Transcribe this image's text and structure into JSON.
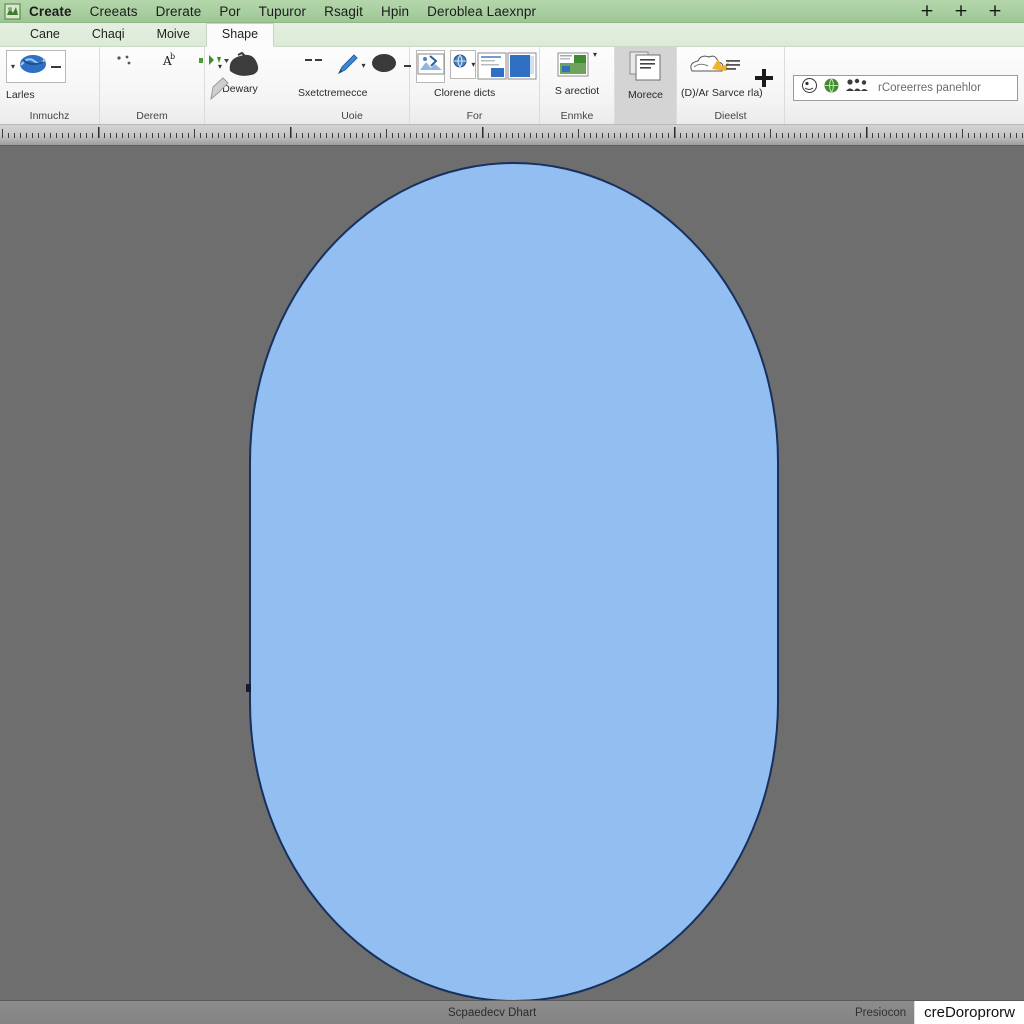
{
  "window": {
    "logo_icon": "app-logo-icon",
    "controls": [
      {
        "name": "minimize-button",
        "glyph": "+"
      },
      {
        "name": "maximize-button",
        "glyph": "+"
      },
      {
        "name": "close-button",
        "glyph": "+"
      }
    ]
  },
  "menubar": {
    "items": [
      {
        "label": "Create"
      },
      {
        "label": "Creeats"
      },
      {
        "label": "Drerate"
      },
      {
        "label": "Por"
      },
      {
        "label": "Tupuror"
      },
      {
        "label": "Rsagit"
      },
      {
        "label": "Hpin"
      },
      {
        "label": "Deroblea Laexnpr"
      }
    ]
  },
  "tabs": {
    "items": [
      {
        "label": "Cane",
        "active": false
      },
      {
        "label": "Chaqi",
        "active": false
      },
      {
        "label": "Moive",
        "active": false
      },
      {
        "label": "Shape",
        "active": true
      }
    ]
  },
  "ribbon": {
    "groups": [
      {
        "caption": "Inmuchz",
        "items": [
          {
            "label": "Larles",
            "icon": "scribble-blue-icon",
            "boxed": true,
            "caret": true
          },
          {
            "label": "",
            "icon": "dots-small-icon",
            "caret": false
          },
          {
            "label": "",
            "icon": "tiny-dots-icon",
            "caret": false
          }
        ]
      },
      {
        "caption": "Derem",
        "items": [
          {
            "label": "",
            "icon": "letter-a-icon",
            "caret": false
          },
          {
            "label": "",
            "icon": "green-arrow-icon",
            "caret": true
          },
          {
            "label": "Dewary",
            "icon": "dark-blob-icon",
            "caret": true
          }
        ]
      },
      {
        "caption": "Uoie",
        "items": [
          {
            "label": "",
            "icon": "dash-pair-icon",
            "caret": false
          },
          {
            "label": "",
            "icon": "blue-pen-icon",
            "caret": false
          },
          {
            "label": "Sxetctremecce",
            "icon": "dark-oval-icon",
            "caret": true
          }
        ]
      },
      {
        "caption": "For",
        "items": [
          {
            "label": "",
            "icon": "picture-tools-icon",
            "boxed": true,
            "caret": false
          },
          {
            "label": "",
            "icon": "globe-small-icon",
            "boxed": true,
            "caret": true
          },
          {
            "label": "Clorene dicts",
            "icon": "two-slides-icon",
            "boxed": true,
            "caret": false
          }
        ]
      },
      {
        "caption": "Enmke",
        "items": [
          {
            "label": "S arectiot",
            "icon": "chart-window-icon",
            "caret": true
          }
        ]
      },
      {
        "caption": "",
        "items": [
          {
            "label": "Morece",
            "icon": "document-page-icon",
            "selected": true,
            "caret": false
          }
        ]
      },
      {
        "caption": "Dieelst",
        "items": [
          {
            "label": "(D)/Ar Sarvce rla)",
            "icon": "cloud-burst-icon",
            "caret": false
          },
          {
            "label": "",
            "icon": "plus-icon",
            "caret": false
          }
        ]
      }
    ],
    "search": {
      "placeholder": "rCoreerres panehlor",
      "icons": [
        "circle-outline-icon",
        "green-globe-icon",
        "group-people-icon"
      ]
    }
  },
  "canvas": {
    "shape_name": "rounded-oval-shape",
    "fill_color": "#92bef2",
    "stroke_color": "#17305e",
    "background_color": "#6e6e6e",
    "handle_name": "resize-handle-left"
  },
  "statusbar": {
    "center_text": "Scpaedecv Dhart",
    "right_label": "Presiocon",
    "button_label": "creDoroprorw"
  }
}
